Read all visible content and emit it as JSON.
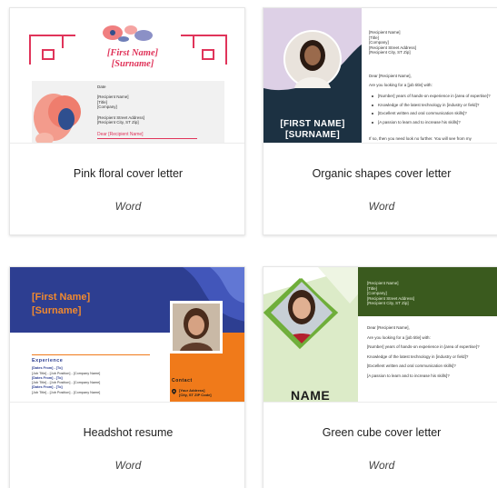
{
  "cards": [
    {
      "title": "Pink floral cover letter",
      "app": "Word",
      "thumb": {
        "name_line1": "[First Name]",
        "name_line2": "[Surname]",
        "lines": [
          "Date",
          "",
          "[Recipient Name]",
          "[Title]",
          "[Company]",
          "",
          "[Recipient Street Address]",
          "[Recipient City, ST Zip]"
        ],
        "dear": "Dear [Recipient Name]"
      }
    },
    {
      "title": "Organic shapes cover letter",
      "app": "Word",
      "thumb": {
        "name_line1": "[FIRST NAME]",
        "name_line2": "[SURNAME]",
        "recipient": [
          "[Recipient Name]",
          "[Title]",
          "[Company]",
          "[Recipient Street Address]",
          "[Recipient City, ST Zip]"
        ],
        "dear": "Dear [Recipient Name],",
        "intro": "Are you looking for a [job title] with:",
        "bullets": [
          "[Number] years of hands-on experience in [area of expertise]?",
          "Knowledge of the latest technology in [industry or field]?",
          "[Excellent written and oral communication skills]?",
          "[A passion to learn and to increase his skills]?"
        ],
        "cut_line": "If so, then you need look no further. You will see from my"
      }
    },
    {
      "title": "Headshot resume",
      "app": "Word",
      "thumb": {
        "name_line1": "[First Name]",
        "name_line2": "[Surname]",
        "experience_heading": "Experience",
        "rows": [
          "[Dates From] - [To]",
          "[Job Title] - [Job Position] - [Company Name]",
          "[Dates From] - [To]",
          "[Job Title] - [Job Position] - [Company Name]",
          "[Dates From] - [To]",
          "[Job Title] - [Job Position] - [Company Name]"
        ],
        "contact_heading": "Contact",
        "address": [
          "[Your Address]",
          "[City, ST ZIP Code]"
        ]
      }
    },
    {
      "title": "Green cube cover letter",
      "app": "Word",
      "thumb": {
        "recipient": [
          "[Recipient Name]",
          "[Title]",
          "[Company]",
          "[Recipient Street Address]",
          "[Recipient City, ST Zip]"
        ],
        "name": "NAME",
        "body": [
          "Dear [Recipient Name],",
          "Are you looking for a [job title] with:",
          "[Number] years of hands-on experience in [area of expertise]?",
          "Knowledge of the latest technology in [industry or field]?",
          "[Excellent written and oral communication skills]?",
          "[A passion to learn and to increase his skills]?"
        ]
      }
    }
  ],
  "colors": {
    "floral_accent": "#e0345a",
    "organic_navy": "#1c3142",
    "organic_lilac": "#ddd0e6",
    "resume_blue": "#2d3e91",
    "resume_orange": "#f07a1a",
    "cube_green": "#3a5a1e",
    "cube_light_green": "#dcebc8"
  }
}
